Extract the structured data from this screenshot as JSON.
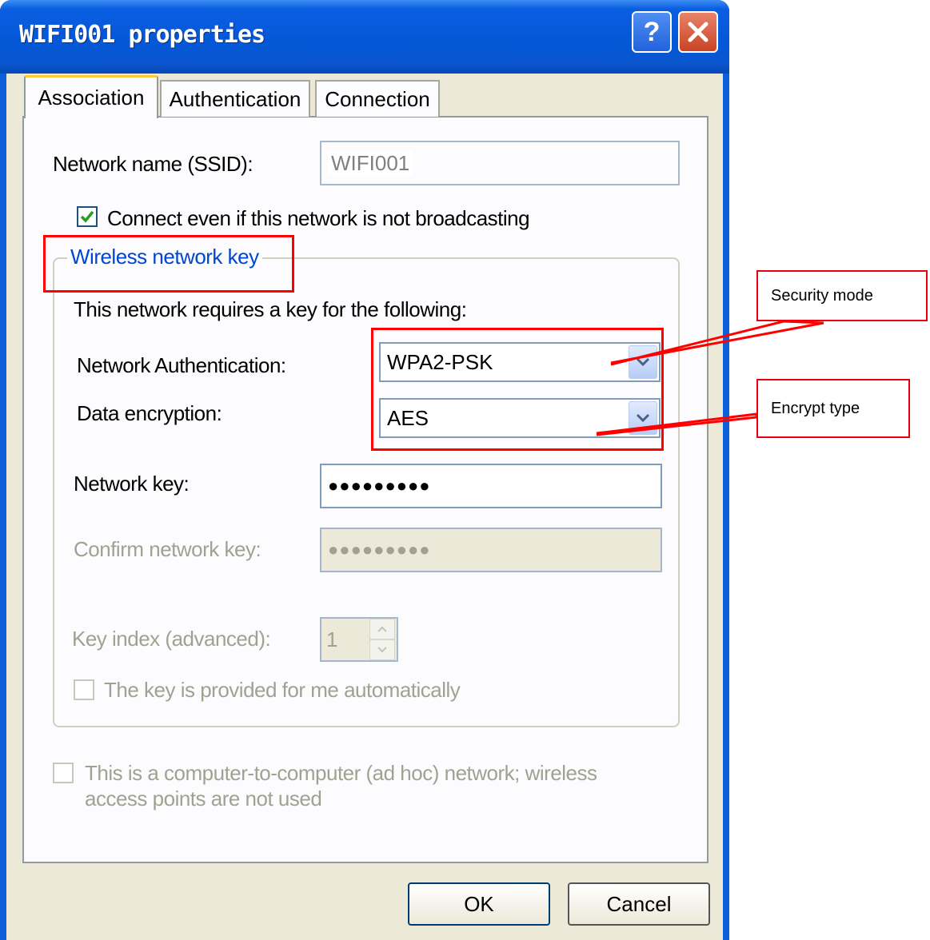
{
  "window": {
    "title": "WIFI001 properties",
    "help_label": "?"
  },
  "tabs": [
    {
      "label": "Association"
    },
    {
      "label": "Authentication"
    },
    {
      "label": "Connection"
    }
  ],
  "association": {
    "ssid_label": "Network name (SSID):",
    "ssid_value": "WIFI001",
    "connect_label": "Connect even if this network is not broadcasting",
    "connect_checked": true,
    "group_title": "Wireless network key",
    "requires_text": "This network requires a key for the following:",
    "auth_label": "Network Authentication:",
    "auth_value": "WPA2-PSK",
    "encryption_label": "Data encryption:",
    "encryption_value": "AES",
    "key_label": "Network key:",
    "key_value": "●●●●●●●●●",
    "confirm_label": "Confirm network key:",
    "confirm_value": "●●●●●●●●●",
    "key_index_label": "Key index (advanced):",
    "key_index_value": "1",
    "auto_key_label": "The key is provided for me automatically",
    "adhoc_line1": "This is a computer-to-computer (ad hoc) network; wireless",
    "adhoc_line2": "access points are not used"
  },
  "buttons": {
    "ok": "OK",
    "cancel": "Cancel"
  },
  "annotations": {
    "security_mode": "Security mode",
    "encrypt_type": "Encrypt type",
    "highlight_color": "#ff0000"
  },
  "icons": [
    "help-icon",
    "close-icon",
    "checkmark-icon",
    "chevron-down-icon",
    "spin-up-icon",
    "spin-down-icon"
  ]
}
